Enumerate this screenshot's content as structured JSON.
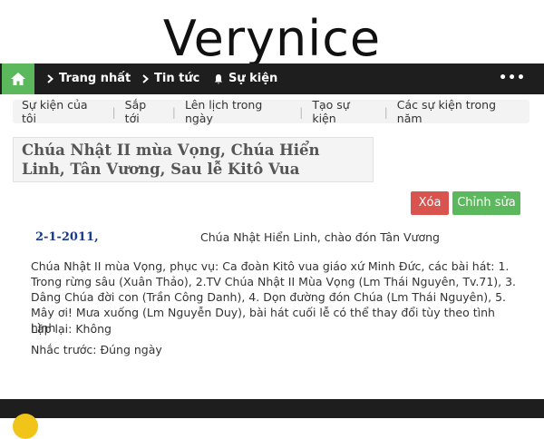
{
  "site": {
    "logo": "Verynice"
  },
  "nav": {
    "home_icon": "home-icon",
    "items": [
      {
        "label": "Trang nhất",
        "icon": "chevron-right-icon"
      },
      {
        "label": "Tin tức",
        "icon": "chevron-right-icon"
      },
      {
        "label": "Sự kiện",
        "icon": "bell-icon"
      }
    ],
    "more": "•••"
  },
  "tabs": [
    "Sự kiện của tôi",
    "Sắp tới",
    "Lên lịch trong ngày",
    "Tạo sự kiện",
    "Các sự kiện trong năm"
  ],
  "event": {
    "title": "Chúa Nhật II mùa Vọng, Chúa Hiển Linh, Tân Vương, Sau lễ Kitô Vua",
    "date": "2-1-2011,",
    "subtitle": "Chúa Nhật Hiển Linh, chào đón Tân Vương",
    "description": "Chúa Nhật II mùa Vọng, phục vụ: Ca đoàn Kitô vua giáo xứ Minh Đức, các bài hát: 1. Trong rừng sâu (Xuân Thảo), 2.TV Chúa Nhật II Mùa Vọng (Lm Thái Nguyên, Tv.71), 3. Dâng Chúa đời con (Trần Công Danh), 4. Dọn đường đón Chúa (Lm Thái Nguyên), 5. Mây ơi! Mưa xuống (Lm Nguyễn Duy), bài hát cuối lễ có thể thay đổi tùy theo tình hình",
    "repeat": "Lặp lại: Không",
    "remind": "Nhắc trước: Đúng ngày"
  },
  "actions": {
    "delete": "Xóa",
    "edit": "Chỉnh sửa"
  },
  "colors": {
    "navbar": "#1e1e1e",
    "green": "#5cb85c",
    "red": "#d9534f",
    "date": "#1a3a8a"
  }
}
